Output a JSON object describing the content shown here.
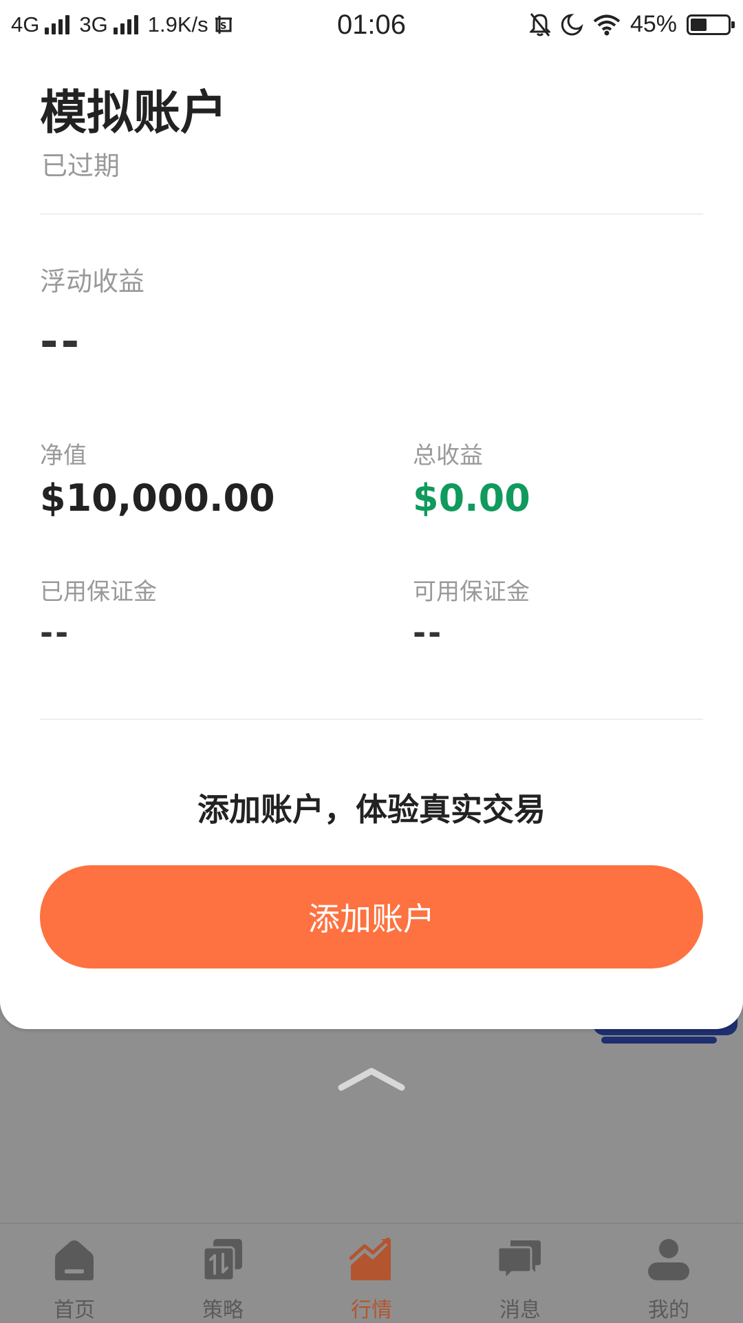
{
  "status_bar": {
    "network1": "4G",
    "network2": "3G",
    "speed": "1.9K/s",
    "time": "01:06",
    "battery": "45%",
    "battery_level": 0.45
  },
  "account": {
    "title": "模拟账户",
    "status": "已过期",
    "floating_pnl_label": "浮动收益",
    "floating_pnl_value": "--",
    "net_value_label": "净值",
    "net_value": "$10,000.00",
    "total_pnl_label": "总收益",
    "total_pnl_value": "$0.00",
    "used_margin_label": "已用保证金",
    "used_margin_value": "--",
    "available_margin_label": "可用保证金",
    "available_margin_value": "--"
  },
  "promo": {
    "text": "添加账户，体验真实交易",
    "button_label": "添加账户"
  },
  "colors": {
    "accent": "#fd7240",
    "positive": "#109a5c",
    "active_tab": "#b3552f"
  },
  "tabs": [
    {
      "label": "首页",
      "icon": "home-icon",
      "active": false
    },
    {
      "label": "策略",
      "icon": "strategy-icon",
      "active": false
    },
    {
      "label": "行情",
      "icon": "market-chart-icon",
      "active": true
    },
    {
      "label": "消息",
      "icon": "message-icon",
      "active": false
    },
    {
      "label": "我的",
      "icon": "profile-icon",
      "active": false
    }
  ]
}
